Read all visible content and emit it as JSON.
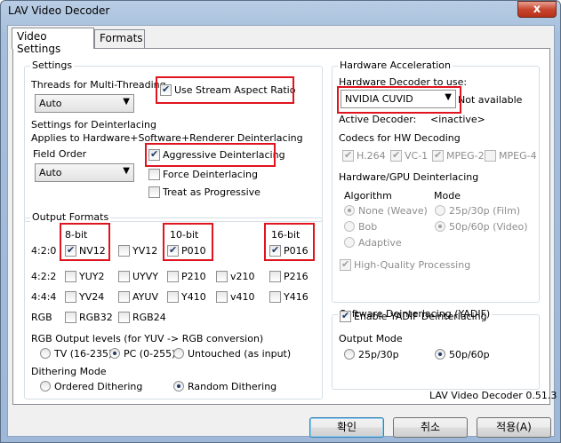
{
  "window": {
    "title": "LAV Video Decoder",
    "close_label": "x"
  },
  "tabs": [
    {
      "label": "Video Settings"
    },
    {
      "label": "Formats"
    }
  ],
  "settings": {
    "legend": "Settings",
    "threads_label": "Threads for Multi-Threading",
    "threads_value": "Auto",
    "use_aspect": "Use Stream Aspect Ratio",
    "deint_title": "Settings for Deinterlacing",
    "deint_sub": "Applies to Hardware+Software+Renderer Deinterlacing",
    "aggressive": "Aggressive Deinterlacing",
    "field_order_label": "Field Order",
    "field_order_value": "Auto",
    "force": "Force Deinterlacing",
    "treat": "Treat as Progressive"
  },
  "output": {
    "legend": "Output Formats",
    "h8": "8-bit",
    "h10": "10-bit",
    "h16": "16-bit",
    "r420": "4:2:0",
    "r422": "4:2:2",
    "r444": "4:4:4",
    "rgb": "RGB",
    "nv12": "NV12",
    "yv12": "YV12",
    "p010": "P010",
    "p016": "P016",
    "yuy2": "YUY2",
    "uyvy": "UYVY",
    "p210": "P210",
    "v210": "v210",
    "p216": "P216",
    "yv24": "YV24",
    "ayuv": "AYUV",
    "y410": "Y410",
    "v410": "v410",
    "y416": "Y416",
    "rgb32": "RGB32",
    "rgb24": "RGB24",
    "rgb_levels_label": "RGB Output levels (for YUV -> RGB conversion)",
    "tv": "TV (16-235)",
    "pc": "PC (0-255)",
    "untouched": "Untouched (as input)",
    "dither_label": "Dithering Mode",
    "ordered": "Ordered Dithering",
    "random": "Random Dithering"
  },
  "hw": {
    "legend": "Hardware Acceleration",
    "decoder_label": "Hardware Decoder to use:",
    "decoder_value": "NVIDIA CUVID",
    "status": "Not available",
    "active_label": "Active Decoder:",
    "active_value": "<inactive>",
    "codecs_label": "Codecs for HW Decoding",
    "h264": "H.264",
    "vc1": "VC-1",
    "mpeg2": "MPEG-2",
    "mpeg4": "MPEG-4",
    "gpu_deint": "Hardware/GPU Deinterlacing",
    "algorithm": "Algorithm",
    "mode": "Mode",
    "weave": "None (Weave)",
    "bob": "Bob",
    "adaptive": "Adaptive",
    "film": "25p/30p (Film)",
    "video": "50p/60p (Video)",
    "hq": "High-Quality Processing"
  },
  "yadif": {
    "legend": "Software Deinterlacing (YADIF)",
    "enable": "Enable YADIF Deinterlacing",
    "output_mode": "Output Mode",
    "m25": "25p/30p",
    "m50": "50p/60p"
  },
  "version": "LAV Video Decoder 0.51.3",
  "buttons": {
    "ok": "확인",
    "cancel": "취소",
    "apply": "적용(A)"
  }
}
